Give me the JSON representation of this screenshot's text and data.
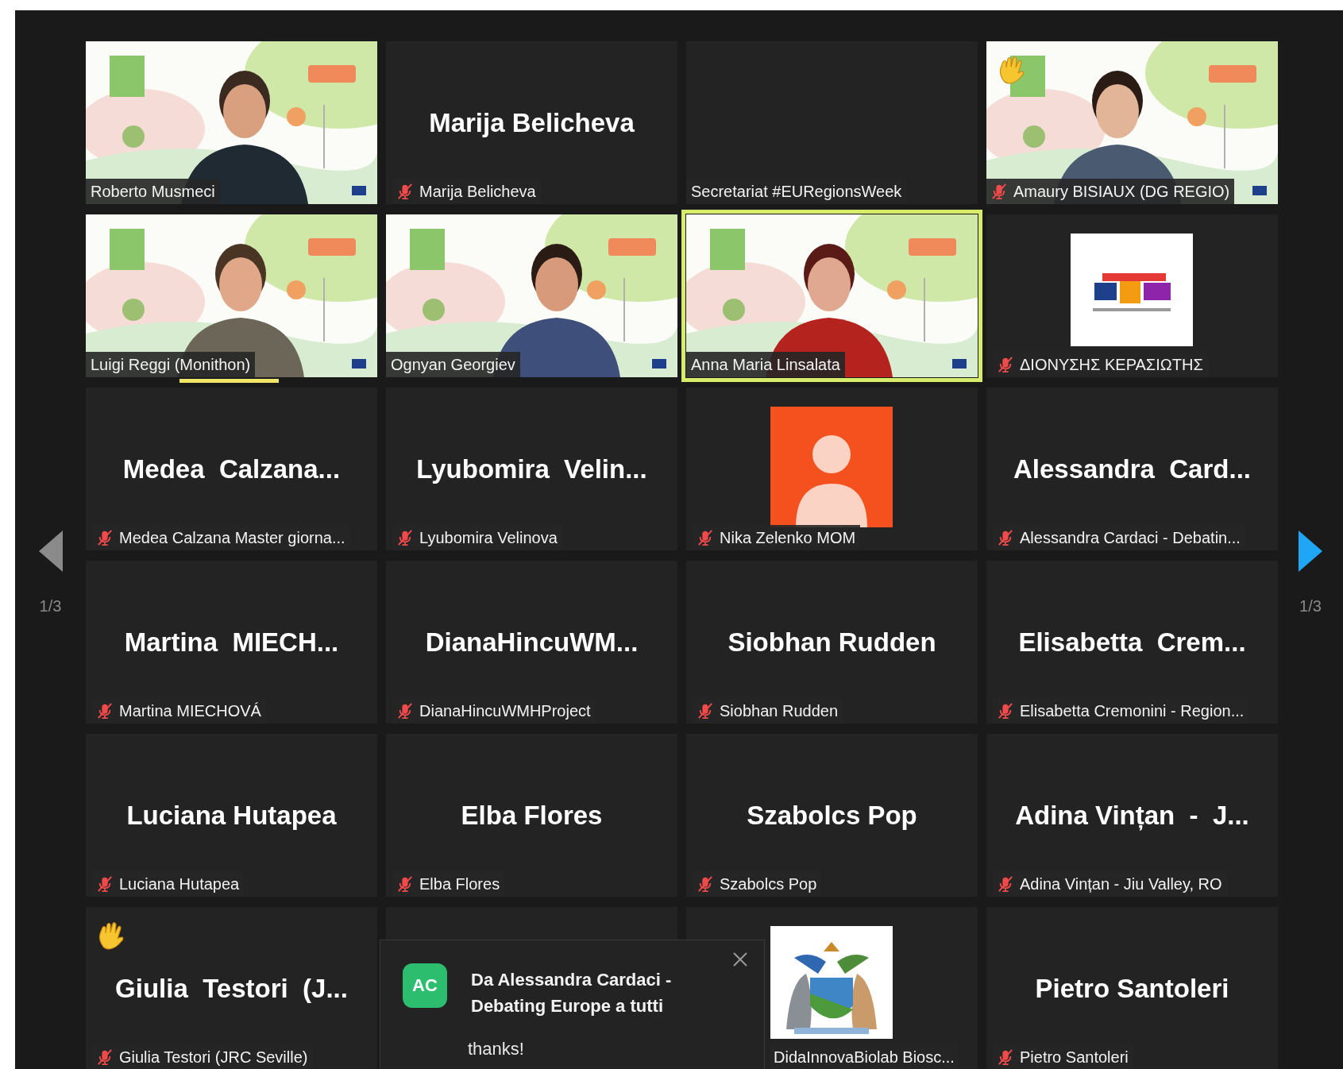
{
  "pager": {
    "previous": {
      "label": "1/3",
      "enabled": false
    },
    "next": {
      "label": "1/3",
      "enabled": true
    }
  },
  "tiles": [
    {
      "kind": "video",
      "label": "Roberto Musmeci",
      "muted": false
    },
    {
      "kind": "name",
      "display_name": "Marija Belicheva",
      "label": "Marija Belicheva",
      "muted": true
    },
    {
      "kind": "blank",
      "label": "Secretariat #EURegionsWeek",
      "muted": false
    },
    {
      "kind": "video",
      "label": "Amaury BISIAUX (DG REGIO)",
      "muted": true,
      "hand_raised": true
    },
    {
      "kind": "video",
      "label": "Luigi Reggi (Monithon)",
      "muted": false,
      "speaking": true
    },
    {
      "kind": "video",
      "label": "Ognyan Georgiev",
      "muted": false
    },
    {
      "kind": "video",
      "label": "Anna Maria Linsalata",
      "muted": false,
      "active_speaker": true
    },
    {
      "label": "ΔΙΟΝΥΣΗΣ ΚΕΡΑΣΙΩΤΗΣ",
      "muted": true
    },
    {
      "kind": "name",
      "display_name": "Medea  Calzana...",
      "label": "Medea Calzana Master giorna...",
      "muted": true
    },
    {
      "kind": "name",
      "display_name": "Lyubomira  Velin...",
      "label": "Lyubomira Velinova",
      "muted": true
    },
    {
      "kind": "avatar",
      "label": "Nika Zelenko MOM",
      "muted": true,
      "color": "#f4511e"
    },
    {
      "kind": "name",
      "display_name": "Alessandra  Card...",
      "label": "Alessandra Cardaci - Debatin...",
      "muted": true
    },
    {
      "kind": "name",
      "display_name": "Martina  MIECH...",
      "label": "Martina MIECHOVÁ",
      "muted": true
    },
    {
      "kind": "name",
      "display_name": "DianaHincuWM...",
      "label": "DianaHincuWMHProject",
      "muted": true
    },
    {
      "kind": "name",
      "display_name": "Siobhan Rudden",
      "label": "Siobhan Rudden",
      "muted": true
    },
    {
      "kind": "name",
      "display_name": "Elisabetta  Crem...",
      "label": "Elisabetta Cremonini - Region...",
      "muted": true
    },
    {
      "kind": "name",
      "display_name": "Luciana Hutapea",
      "label": "Luciana Hutapea",
      "muted": true
    },
    {
      "kind": "name",
      "display_name": "Elba Flores",
      "label": "Elba Flores",
      "muted": true
    },
    {
      "kind": "name",
      "display_name": "Szabolcs Pop",
      "label": "Szabolcs Pop",
      "muted": true
    },
    {
      "kind": "name",
      "display_name": "Adina Vințan  -  J...",
      "label": "Adina Vințan - Jiu Valley, RO",
      "muted": true
    },
    {
      "kind": "name",
      "display_name": "Giulia  Testori  (J...",
      "label": "Giulia Testori (JRC Seville)",
      "muted": true,
      "hand_raised": true
    },
    {
      "kind": "covered"
    },
    {
      "label": "DidaInnovaBiolab Biosc...",
      "muted": false
    },
    {
      "kind": "name",
      "display_name": "Pietro Santoleri",
      "label": "Pietro Santoleri",
      "muted": true
    }
  ],
  "notification": {
    "initials": "AC",
    "color": "#2dbd6e",
    "title": "Da Alessandra Cardaci - Debating Europe a tutti",
    "message": "thanks!"
  }
}
